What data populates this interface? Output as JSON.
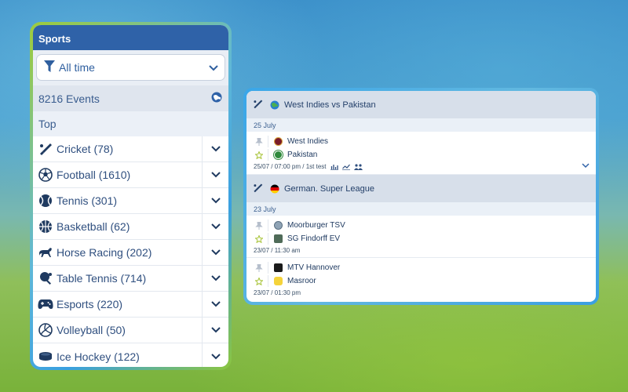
{
  "sports_panel": {
    "title": "Sports",
    "filter": {
      "label": "All time",
      "icon": "filter-icon",
      "chevron": "chevron-down-icon"
    },
    "events": {
      "label": "8216 Events",
      "icon": "globe-icon"
    },
    "top_label": "Top",
    "items": [
      {
        "label": "Cricket (78)",
        "icon": "cricket-icon"
      },
      {
        "label": "Football (1610)",
        "icon": "football-icon"
      },
      {
        "label": "Tennis (301)",
        "icon": "tennis-icon"
      },
      {
        "label": "Basketball (62)",
        "icon": "basketball-icon"
      },
      {
        "label": "Horse Racing (202)",
        "icon": "horse-icon"
      },
      {
        "label": "Table Tennis (714)",
        "icon": "table-tennis-icon"
      },
      {
        "label": "Esports (220)",
        "icon": "gamepad-icon"
      },
      {
        "label": "Volleyball (50)",
        "icon": "volleyball-icon"
      },
      {
        "label": "Ice Hockey (122)",
        "icon": "ice-hockey-icon"
      }
    ]
  },
  "matches_panel": {
    "sections": [
      {
        "league": "West Indies vs Pakistan",
        "date": "25 July",
        "matches": [
          {
            "team1": "West Indies",
            "team2": "Pakistan",
            "meta": "25/07 / 07:00 pm / 1st test"
          }
        ]
      },
      {
        "league": "German. Super League",
        "date": "23 July",
        "matches": [
          {
            "team1": "Moorburger TSV",
            "team2": "SG Findorff EV",
            "meta": "23/07 / 11:30 am"
          },
          {
            "team1": "MTV Hannover",
            "team2": "Masroor",
            "meta": "23/07 / 01:30 pm"
          }
        ]
      }
    ]
  },
  "colors": {
    "header_blue": "#2f62a8",
    "text_blue": "#2f5f9f",
    "panel_border_green": "#9fcc3a",
    "panel_border_blue": "#3aa6e8"
  }
}
